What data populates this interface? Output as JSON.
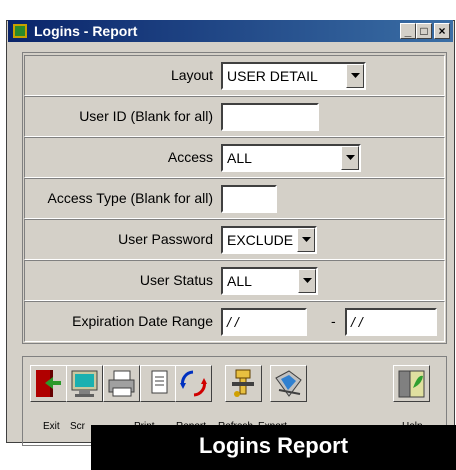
{
  "window": {
    "title": "Logins - Report"
  },
  "form": {
    "layout_label": "Layout",
    "layout_value": "USER DETAIL",
    "userid_label": "User ID (Blank for all)",
    "userid_value": "",
    "access_label": "Access",
    "access_value": "ALL",
    "accesstype_label": "Access Type (Blank for all)",
    "accesstype_value": "",
    "password_label": "User Password",
    "password_value": "EXCLUDE",
    "status_label": "User Status",
    "status_value": "ALL",
    "expiration_label": "Expiration Date Range",
    "date_from": "/ /",
    "date_sep": "-",
    "date_to": "/ /"
  },
  "toolbar": {
    "exit": "Exit",
    "screen": "Scr",
    "print": "Print",
    "report": "Report",
    "refresh": "Refresh",
    "export": "Export",
    "help": "Help"
  },
  "banner": {
    "text": "Logins Report"
  }
}
